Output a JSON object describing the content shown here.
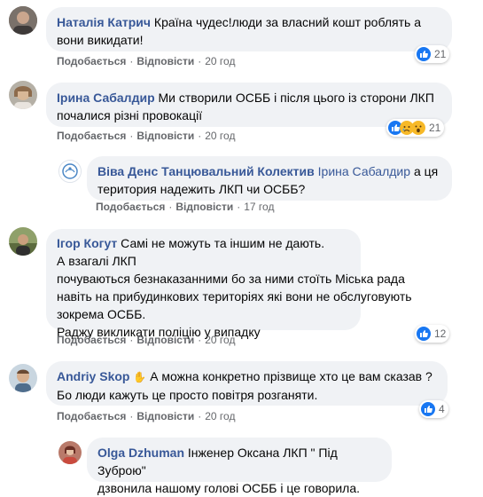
{
  "actions": {
    "like": "Подобається",
    "reply": "Відповісти"
  },
  "comments": [
    {
      "author": "Наталія Катрич",
      "text1": "Країна чудес!люди за власний кошт роблять а",
      "text2": "вони викидати!",
      "time": "20 год",
      "reactions": "21"
    },
    {
      "author": "Ірина Сабалдир",
      "text1": "Ми створили ОСББ і після цього із сторони ЛКП",
      "text2": "почалися різні провокації",
      "time": "20 год",
      "reactions": "21"
    },
    {
      "author": "Віва Денс Танцювальний Колектив",
      "tag": "Ірина Сабалдир",
      "text1": "а ця",
      "text2": "територия надежить ЛКП чи ОСББ?",
      "time": "17 год"
    },
    {
      "author": "Ігор Когут",
      "lines": [
        "Самі не можуть та іншим не дають.",
        "А взагалі ЛКП",
        "почуваються безнаказанними бо за ними стоїть Міська рада",
        "навіть на прибудинкових територіях які вони не обслуговують",
        "зокрема ОСББ.",
        "Раджу викликати поліцію у випадку"
      ],
      "time": "20 год",
      "reactions": "12"
    },
    {
      "author": "Andriy Skop",
      "text1": "А можна конкретно прізвище хто це вам сказав ?",
      "text2": "Бо люди кажуть це просто повітря розганяти.",
      "time": "20 год",
      "reactions": "4"
    },
    {
      "author": "Olga Dzhuman",
      "text1": "Інженер Оксана ЛКП \" Під Зуброю\"",
      "text2": "дзвонила нашому голові ОСББ і це говорила."
    }
  ],
  "colors": {
    "author": "#385898",
    "bubble": "#f0f2f5",
    "like": "#1877f2",
    "love": "#f33e58",
    "haha": "#f7b928"
  },
  "icons": [
    "like-icon",
    "love-icon",
    "sad-icon",
    "wow-icon",
    "waving-hand-icon"
  ]
}
